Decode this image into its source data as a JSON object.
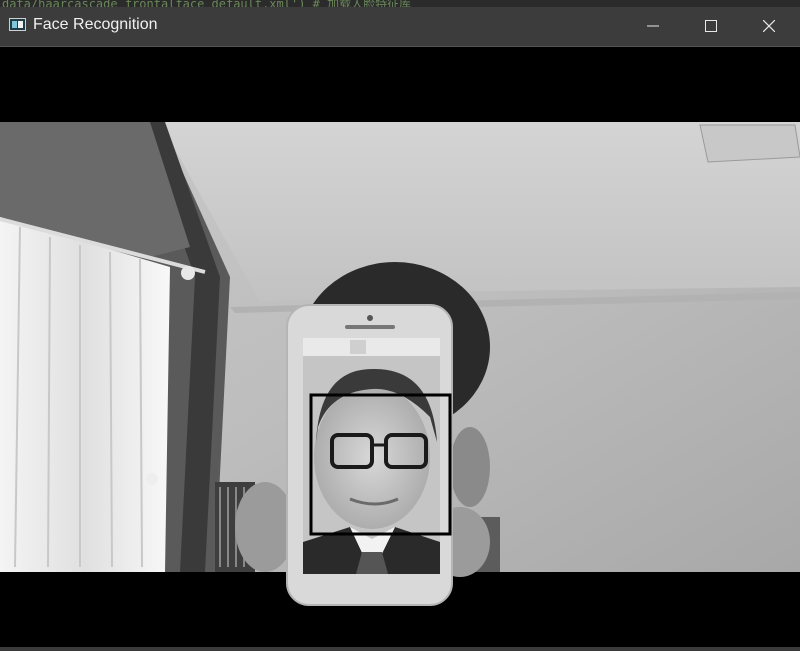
{
  "background_editor": {
    "code_line": "data/haarcascade_frontalface_default.xml') # 加载人脸特征库"
  },
  "window": {
    "title": "Face Recognition",
    "icon": "python-window-icon",
    "controls": {
      "minimize_icon": "minimize-icon",
      "maximize_icon": "maximize-icon",
      "close_icon": "close-icon"
    }
  },
  "video": {
    "mode": "grayscale",
    "detections": [
      {
        "label": "face"
      }
    ],
    "detection_box_color": "#000000"
  },
  "colors": {
    "titlebar": "#3c3c3c",
    "title_text": "#f0f0f0",
    "letterbox": "#000000"
  }
}
